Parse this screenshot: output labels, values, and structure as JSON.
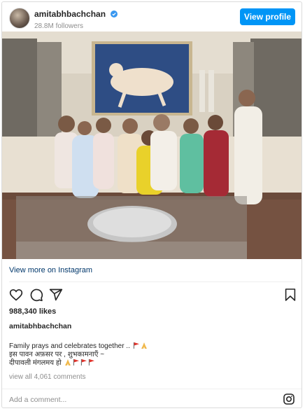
{
  "header": {
    "username": "amitabhbachchan",
    "followers": "28.8M followers",
    "view_profile_label": "View profile"
  },
  "photo": {
    "alt": "Family photo"
  },
  "view_more_label": "View more on Instagram",
  "icons": {
    "like": "heart-icon",
    "comment": "comment-icon",
    "share": "share-icon",
    "save": "bookmark-icon",
    "instagram": "instagram-icon"
  },
  "likes": "988,340 likes",
  "caption": {
    "username": "amitabhbachchan",
    "line1": "Family prays and celebrates together ..",
    "line2": "इस पावन अफ़सर पर , शुभकामनाएँ ~",
    "line3": "दीपावली मंगलमय हो"
  },
  "view_comments": "view all 4,061 comments",
  "comment_placeholder": "Add a comment...",
  "colors": {
    "accent": "#0095f6",
    "link": "#00376b",
    "muted": "#8e8e8e",
    "flag": "#e0332b"
  }
}
